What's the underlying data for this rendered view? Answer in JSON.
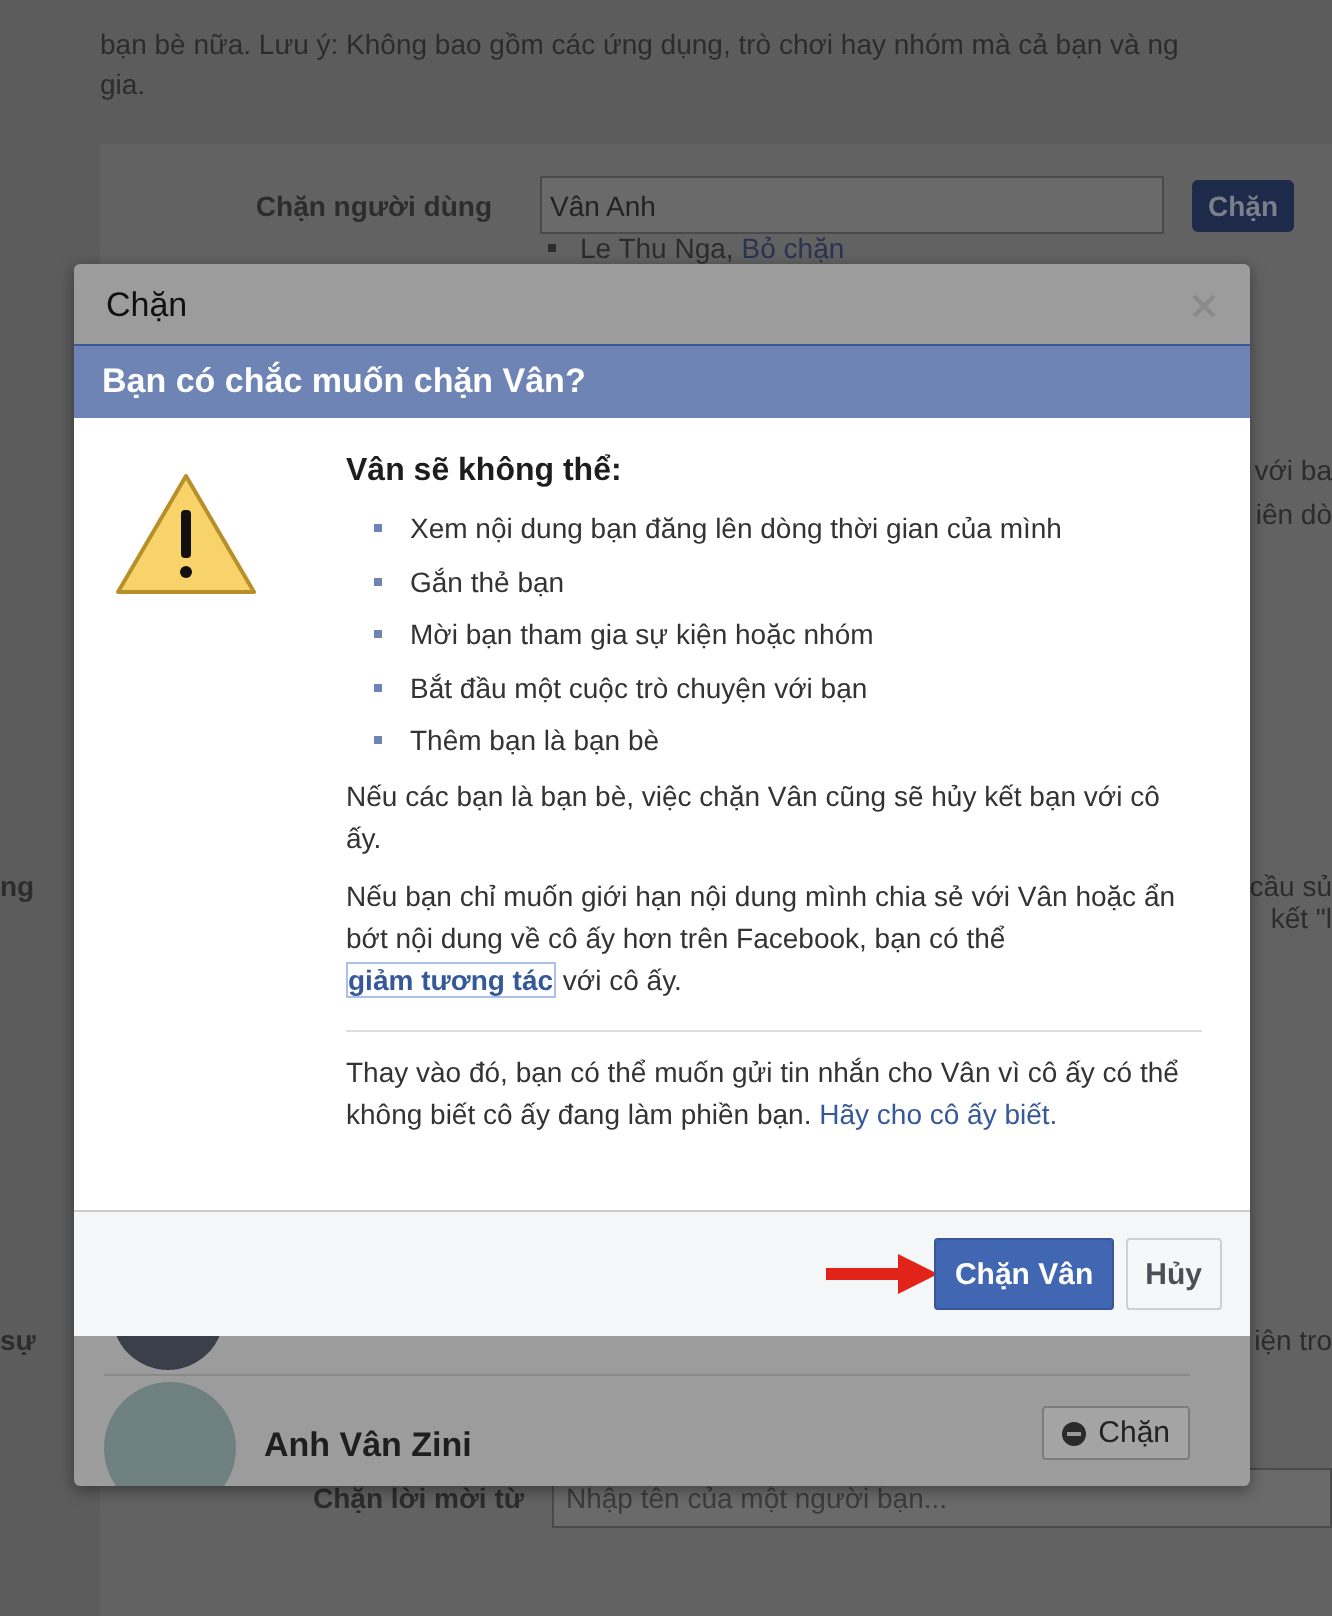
{
  "background_page": {
    "notice_lines": [
      "bạn bè nữa. Lưu ý: Không bao gồm các ứng dụng, trò chơi hay nhóm mà cả bạn và ng",
      "gia."
    ],
    "block_user": {
      "label": "Chặn người dùng",
      "value": "Vân Anh",
      "button": "Chặn"
    },
    "blocked_list": [
      {
        "name": "Le Thu Nga,",
        "action": "Bỏ chặn"
      }
    ],
    "fragment_rows": [
      {
        "left": "",
        "right": "với ba"
      },
      {
        "left": "",
        "right": "iên dò"
      },
      {
        "left": "ng",
        "right": "cầu sủ"
      },
      {
        "left": "",
        "right": "kết \"l"
      },
      {
        "left": "sự",
        "right": "iện tro"
      }
    ],
    "block_invites": {
      "label": "Chặn lời mời từ",
      "placeholder": "Nhập tên của một người bạn..."
    }
  },
  "block_dialog": {
    "title": "Chặn",
    "results": [
      {
        "name": "Anh Vân Zini",
        "button": "Chặn"
      }
    ]
  },
  "confirm_dialog": {
    "title": "Bạn có chắc muốn chặn Vân?",
    "heading": "Vân sẽ không thể:",
    "restrictions": [
      "Xem nội dung bạn đăng lên dòng thời gian của mình",
      "Gắn thẻ bạn",
      "Mời bạn tham gia sự kiện hoặc nhóm",
      "Bắt đầu một cuộc trò chuyện với bạn",
      "Thêm bạn là bạn bè"
    ],
    "unfriend_note": "Nếu các bạn là bạn bè, việc chặn Vân cũng sẽ hủy kết bạn với cô ấy.",
    "limit_note": "Nếu bạn chỉ muốn giới hạn nội dung mình chia sẻ với Vân hoặc ẩn bớt nội dung về cô ấy hơn trên Facebook, bạn có thể",
    "limit_link": "giảm tương tác",
    "limit_tail": "với cô ấy.",
    "message_note": "Thay vào đó, bạn có thể muốn gửi tin nhắn cho Vân vì cô ấy có thể không biết cô ấy đang làm phiền bạn.",
    "message_link": "Hãy cho cô ấy biết.",
    "confirm_button": "Chặn Vân",
    "cancel_button": "Hủy"
  }
}
